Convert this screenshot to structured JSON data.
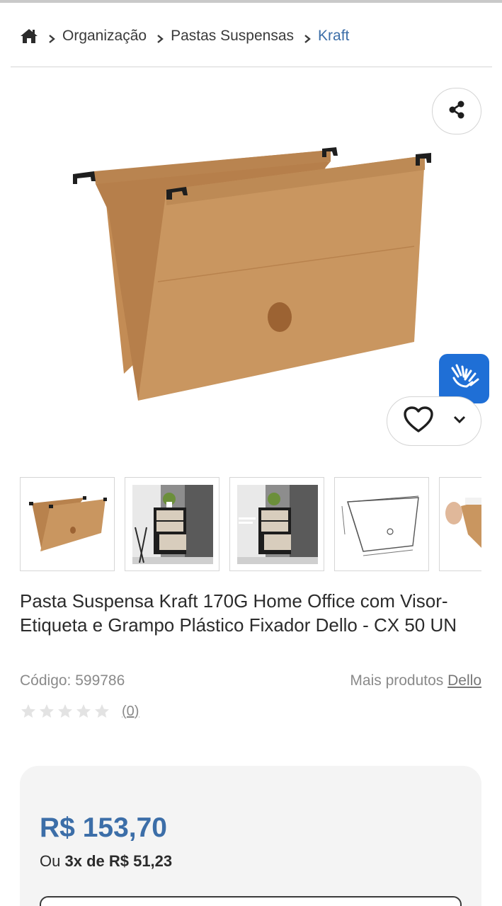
{
  "breadcrumb": {
    "home_icon": "home-icon",
    "items": [
      {
        "label": "Organização"
      },
      {
        "label": "Pastas Suspensas"
      },
      {
        "label": "Kraft"
      }
    ]
  },
  "product": {
    "title": "Pasta Suspensa Kraft 170G Home Office com Visor-Etiqueta e Grampo Plástico Fixador Dello - CX 50 UN",
    "code_text": "Código: 599786",
    "more_products_label": "Mais produtos",
    "brand": "Dello",
    "rating_value": 0,
    "rating_max": 5,
    "review_count": "(0)"
  },
  "price": {
    "amount": "R$ 153,70",
    "installments_prefix": "Ou",
    "installments_value": "3x de R$ 51,23"
  },
  "thumbnails": [
    {
      "name": "thumb-kraft-folder"
    },
    {
      "name": "thumb-drawer-cabinet"
    },
    {
      "name": "thumb-drawer-organization"
    },
    {
      "name": "thumb-dimension-drawing"
    },
    {
      "name": "thumb-hand-folder"
    }
  ],
  "colors": {
    "accent": "#3c6ea8",
    "a11y_button": "#1f6fd6",
    "kraft": "#c8955c"
  }
}
